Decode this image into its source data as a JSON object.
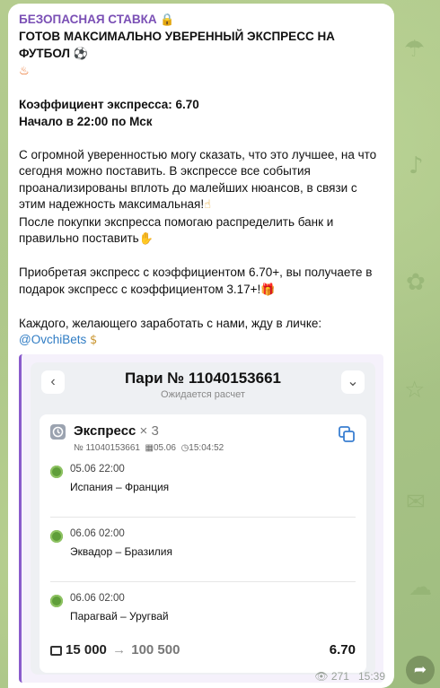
{
  "post": {
    "channel": "БЕЗОПАСНАЯ СТАВКА",
    "channel_icon": "lock-icon",
    "headline": "ГОТОВ МАКСИМАЛЬНО УВЕРЕННЫЙ ЭКСПРЕСС НА ФУТБОЛ",
    "coef_line": "Коэффициент экспресса: 6.70",
    "start_line": "Начало в 22:00 по Мск",
    "p1": "С огромной уверенностью могу сказать, что это лучшее, на что сегодня можно поставить. В экспрессе все события проанализированы вплоть до малейших нюансов, в связи с этим надежность максимальная!",
    "p2": "После покупки экспресса помогаю распределить банк и правильно поставить",
    "p3": "Приобретая экспресс с коэффициентом 6.70+, вы получаете в подарок экспресс с коэффициентом 3.17+!",
    "p4": "Каждого, желающего заработать с нами, жду в личке:",
    "contact": "@OvchiBets"
  },
  "bet": {
    "title": "Пари № 11040153661",
    "status": "Ожидается расчет",
    "type": "Экспресс",
    "count": "× 3",
    "number": "№ 11040153661",
    "date": "05.06",
    "time": "15:04:52",
    "events": [
      {
        "date": "05.06   22:00",
        "teams": "Испания – Франция"
      },
      {
        "date": "06.06   02:00",
        "teams": "Эквадор – Бразилия"
      },
      {
        "date": "06.06   02:00",
        "teams": "Парагвай – Уругвай"
      }
    ],
    "stake": "15 000",
    "win": "100 500",
    "coef": "6.70"
  },
  "footer": {
    "views": "271",
    "time": "15:39"
  },
  "colors": {
    "accent": "#7a4fb5",
    "link": "#2f7cc4",
    "ball": "#5f9e3a"
  }
}
